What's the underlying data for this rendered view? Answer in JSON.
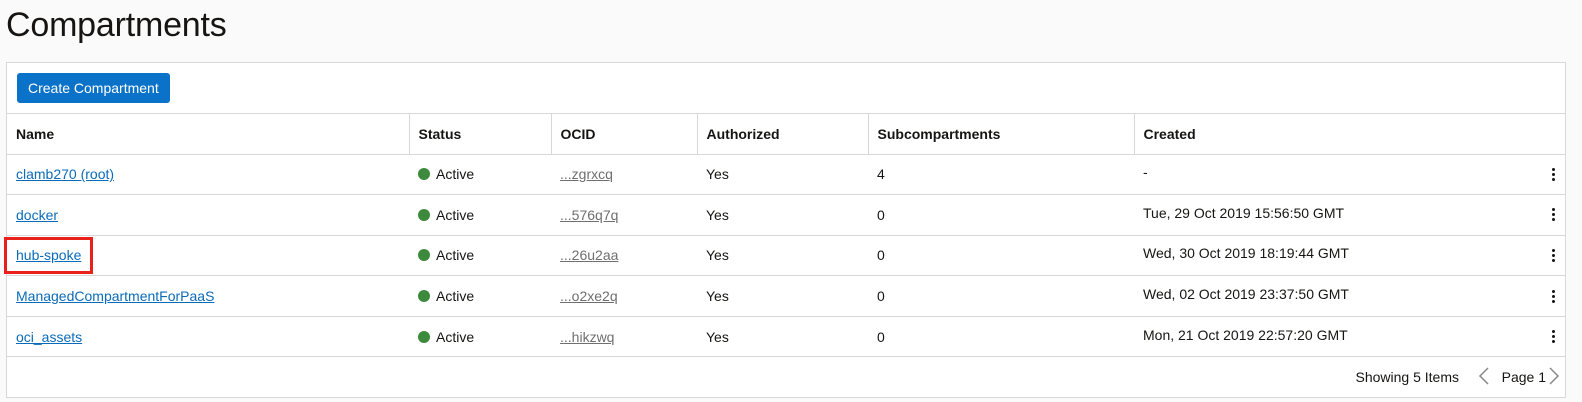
{
  "page": {
    "title": "Compartments"
  },
  "toolbar": {
    "create_label": "Create Compartment"
  },
  "table": {
    "columns": [
      "Name",
      "Status",
      "OCID",
      "Authorized",
      "Subcompartments",
      "Created"
    ],
    "rows": [
      {
        "name": "clamb270 (root)",
        "status": "Active",
        "ocid": "...zgrxcq",
        "authorized": "Yes",
        "subcompartments": "4",
        "created": "-"
      },
      {
        "name": "docker",
        "status": "Active",
        "ocid": "...576q7q",
        "authorized": "Yes",
        "subcompartments": "0",
        "created": "Tue, 29 Oct 2019 15:56:50 GMT"
      },
      {
        "name": "hub-spoke",
        "status": "Active",
        "ocid": "...26u2aa",
        "authorized": "Yes",
        "subcompartments": "0",
        "created": "Wed, 30 Oct 2019 18:19:44 GMT"
      },
      {
        "name": "ManagedCompartmentForPaaS",
        "status": "Active",
        "ocid": "...o2xe2q",
        "authorized": "Yes",
        "subcompartments": "0",
        "created": "Wed, 02 Oct 2019 23:37:50 GMT"
      },
      {
        "name": "oci_assets",
        "status": "Active",
        "ocid": "...hikzwq",
        "authorized": "Yes",
        "subcompartments": "0",
        "created": "Mon, 21 Oct 2019 22:57:20 GMT"
      }
    ]
  },
  "footer": {
    "showing": "Showing 5 Items",
    "page": "Page 1"
  },
  "colors": {
    "primary": "#0b72c9",
    "link": "#0b6bb8",
    "status_active": "#3e8a3c",
    "highlight": "#e8221b"
  },
  "icons": {
    "status": "status-dot-icon",
    "row_actions": "kebab-menu-icon",
    "prev": "chevron-left-icon",
    "next": "chevron-right-icon"
  }
}
